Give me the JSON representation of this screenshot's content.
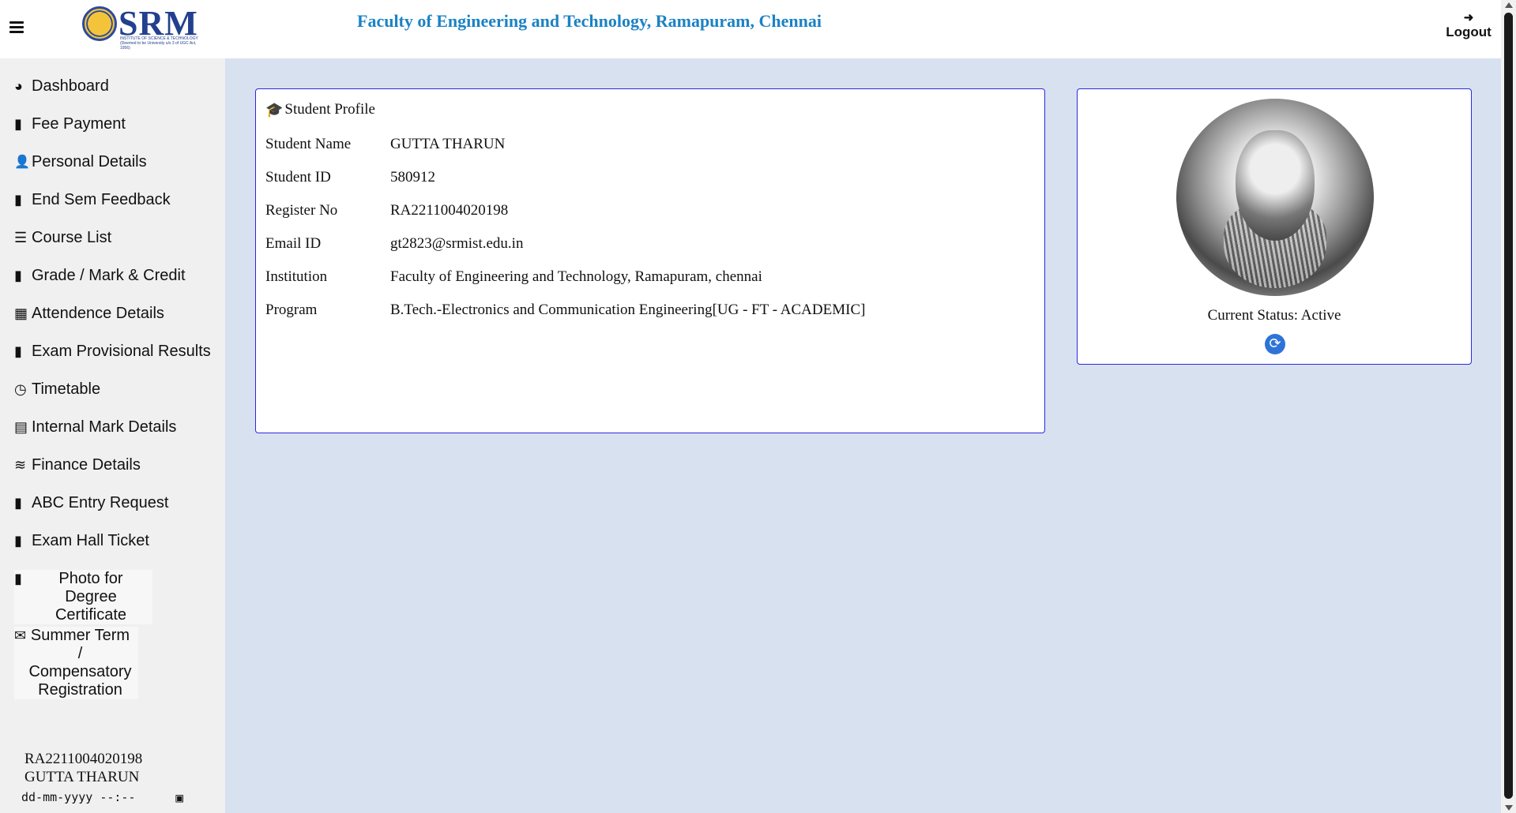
{
  "header": {
    "logo_text": "SRM",
    "logo_subtitle": "INSTITUTE OF SCIENCE & TECHNOLOGY (Deemed to be University u/s 3 of UGC Act, 1956)",
    "title": "Faculty of Engineering and Technology, Ramapuram, Chennai",
    "logout_label": "Logout",
    "menu_icon": "hamburger-icon",
    "logout_icon": "sign-out-icon"
  },
  "sidebar": {
    "items": [
      {
        "label": "Dashboard",
        "icon": "dashboard-icon",
        "glyph": "◕"
      },
      {
        "label": "Fee Payment",
        "icon": "file-icon",
        "glyph": "▮"
      },
      {
        "label": "Personal Details",
        "icon": "user-icon",
        "glyph": "👤"
      },
      {
        "label": "End Sem Feedback",
        "icon": "file-icon",
        "glyph": "▮"
      },
      {
        "label": "Course List",
        "icon": "list-icon",
        "glyph": "☰"
      },
      {
        "label": "Grade / Mark & Credit",
        "icon": "file-icon",
        "glyph": "▮"
      },
      {
        "label": "Attendence Details",
        "icon": "calculator-icon",
        "glyph": "▦"
      },
      {
        "label": "Exam Provisional Results",
        "icon": "file-icon",
        "glyph": "▮"
      },
      {
        "label": "Timetable",
        "icon": "clock-icon",
        "glyph": "◷"
      },
      {
        "label": "Internal Mark Details",
        "icon": "table-icon",
        "glyph": "▤"
      },
      {
        "label": "Finance Details",
        "icon": "coins-icon",
        "glyph": "≋"
      },
      {
        "label": "ABC Entry Request",
        "icon": "file-icon",
        "glyph": "▮"
      },
      {
        "label": "Exam Hall Ticket",
        "icon": "file-icon",
        "glyph": "▮"
      },
      {
        "label": "Photo for Degree Certificate",
        "icon": "file-icon",
        "glyph": "▮"
      },
      {
        "label": "Summer Term / Compensatory Registration",
        "icon": "envelope-icon",
        "glyph": "✉"
      }
    ],
    "register_no": "RA2211004020198",
    "student_name": "GUTTA THARUN",
    "date_placeholder": "dd-mm-yyyy --:--"
  },
  "profile": {
    "title": "Student Profile",
    "title_icon": "graduation-cap-icon",
    "rows": [
      {
        "key": "Student Name",
        "value": "GUTTA THARUN"
      },
      {
        "key": "Student ID",
        "value": "580912"
      },
      {
        "key": "Register No",
        "value": "RA2211004020198"
      },
      {
        "key": "Email ID",
        "value": "gt2823@srmist.edu.in"
      },
      {
        "key": "Institution",
        "value": "Faculty of Engineering and Technology, Ramapuram, chennai"
      },
      {
        "key": "Program",
        "value": "B.Tech.-Electronics and Communication Engineering[UG - FT - ACADEMIC]"
      }
    ]
  },
  "photo_card": {
    "status": "Current Status: Active",
    "refresh_icon": "refresh-icon"
  },
  "colors": {
    "header_title": "#1b82c4",
    "card_border": "#2a2ae0",
    "page_bg": "#d8e1ef",
    "sidebar_bg": "#f0f0f0"
  }
}
